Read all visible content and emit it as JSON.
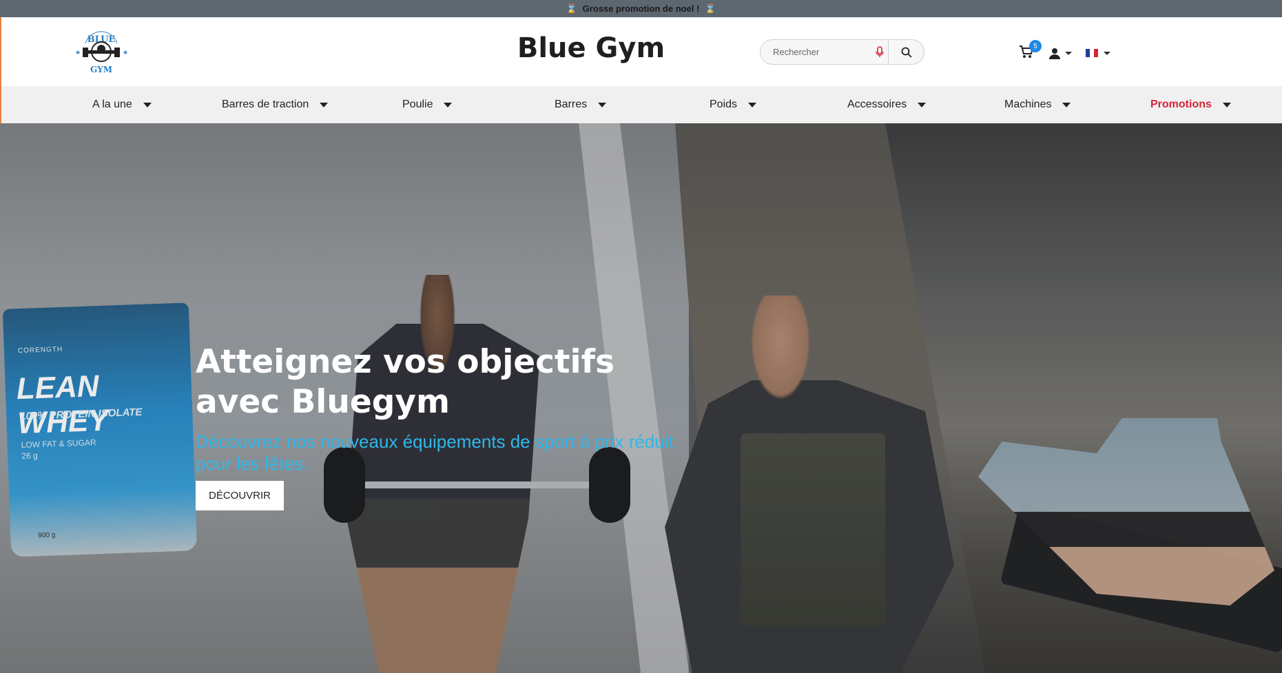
{
  "promo_bar": {
    "icon": "hourglass-icon",
    "text": "Grosse promotion de noel !"
  },
  "header": {
    "logo": {
      "top_text": "BLUE",
      "bottom_text": "GYM"
    },
    "title": "Blue Gym",
    "search": {
      "placeholder": "Rechercher"
    },
    "cart": {
      "count": "5"
    },
    "language": {
      "selected": "FR"
    }
  },
  "nav": {
    "items": [
      {
        "label": "A la une"
      },
      {
        "label": "Barres de traction"
      },
      {
        "label": "Poulie"
      },
      {
        "label": "Barres"
      },
      {
        "label": "Poids"
      },
      {
        "label": "Accessoires"
      },
      {
        "label": "Machines"
      },
      {
        "label": "Promotions"
      }
    ]
  },
  "hero": {
    "title": "Atteignez vos objectifs avec Bluegym",
    "subtitle": "Découvrez nos nouveaux équipements de sport à prix réduit pour les fêtes.",
    "cta": "DÉCOUVRIR",
    "product": {
      "brand": "CORENGTH",
      "name": "LEAN WHEY",
      "subtitle": "100% PROTEIN ISOLATE",
      "claims": "LOW FAT & SUGAR",
      "protein": "26 g",
      "weight": "900 g"
    }
  },
  "colors": {
    "promo_bar_bg": "#5c6770",
    "accent_blue": "#2fb7ea",
    "promotions_red": "#d4243b",
    "badge_blue": "#1e88e5"
  }
}
